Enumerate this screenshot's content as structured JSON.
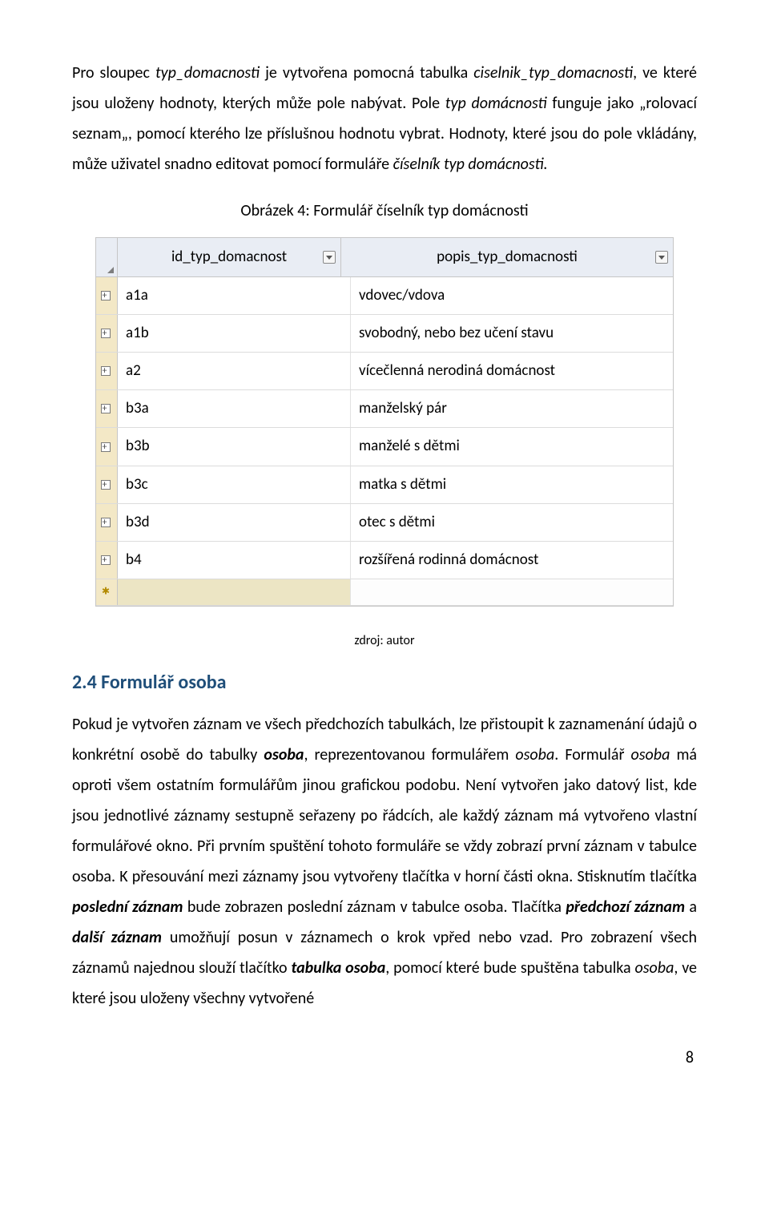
{
  "para1": {
    "t1": "Pro sloupec ",
    "t2": "typ_domacnosti",
    "t3": " je vytvořena pomocná tabulka ",
    "t4": "ciselnik_typ_domacnosti",
    "t5": ", ve které jsou uloženy hodnoty, kterých může pole nabývat. Pole ",
    "t6": "typ domácnosti",
    "t7": " funguje jako „rolovací seznam„, pomocí kterého lze příslušnou hodnotu vybrat. Hodnoty, které jsou do pole vkládány, může uživatel snadno editovat pomocí formuláře ",
    "t8": "číselník typ domácnosti.",
    "t9": ""
  },
  "figure_caption": "Obrázek 4: Formulář číselník typ domácnosti",
  "table": {
    "headers": {
      "id": "id_typ_domacnost",
      "popis": "popis_typ_domacnosti"
    },
    "rows": [
      {
        "id": "a1a",
        "popis": "vdovec/vdova"
      },
      {
        "id": "a1b",
        "popis": "svobodný, nebo bez učení stavu"
      },
      {
        "id": "a2",
        "popis": "vícečlenná nerodiná domácnost"
      },
      {
        "id": "b3a",
        "popis": "manželský pár"
      },
      {
        "id": "b3b",
        "popis": "manželé s dětmi"
      },
      {
        "id": "b3c",
        "popis": "matka s dětmi"
      },
      {
        "id": "b3d",
        "popis": "otec s dětmi"
      },
      {
        "id": "b4",
        "popis": "rozšířená rodinná domácnost"
      }
    ]
  },
  "source": "zdroj: autor",
  "heading": "2.4 Formulář osoba",
  "para2": {
    "t1": "Pokud je vytvořen záznam ve všech předchozích tabulkách, lze přistoupit k zaznamenání údajů o konkrétní osobě do tabulky ",
    "t2": "osoba",
    "t3": ", reprezentovanou formulářem ",
    "t4": "osoba",
    "t5": ". Formulář ",
    "t6": "osoba",
    "t7": " má oproti všem ostatním formulářům jinou grafickou podobu. Není vytvořen jako datový list, kde jsou jednotlivé záznamy sestupně seřazeny po řádcích, ale každý záznam má vytvořeno vlastní formulářové okno. Při prvním spuštění tohoto formuláře se vždy zobrazí první záznam v tabulce osoba. K přesouvání mezi záznamy jsou vytvořeny tlačítka v horní části okna. Stisknutím tlačítka ",
    "t8": "poslední záznam",
    "t9": " bude zobrazen poslední záznam v tabulce osoba. Tlačítka ",
    "t10": "předchozí záznam",
    "t11": " a ",
    "t12": "další záznam",
    "t13": " umožňují posun v záznamech o krok vpřed nebo vzad. Pro zobrazení všech záznamů najednou slouží tlačítko ",
    "t14": "tabulka osoba",
    "t15": ", pomocí které bude spuštěna tabulka ",
    "t16": "osoba",
    "t17": ", ve které jsou uloženy všechny vytvořené"
  },
  "page_number": "8"
}
